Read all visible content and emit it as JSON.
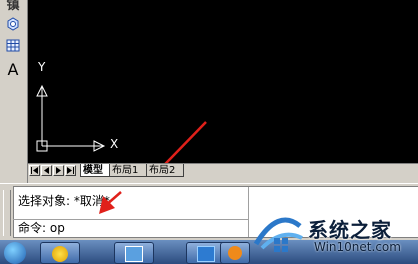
{
  "palette": {
    "edge_glyph": "镇",
    "text_tool_glyph": "A",
    "icons": [
      "hatch-icon",
      "region-icon",
      "table-icon",
      "text-tool-icon"
    ]
  },
  "canvas": {
    "background": "#000000",
    "ucs": {
      "y_label": "Y",
      "x_label": "X"
    },
    "arrow_color": "#e0201a"
  },
  "tabs": {
    "nav_buttons": [
      "first",
      "previous",
      "next",
      "last"
    ],
    "items": [
      {
        "label": "模型",
        "active": true
      },
      {
        "label": "布局1",
        "active": false
      },
      {
        "label": "布局2",
        "active": false
      }
    ]
  },
  "command": {
    "history_line": "选择对象: *取消*",
    "prompt_line": "命令: op"
  },
  "watermark": {
    "title": "系统之家",
    "url": "Win10net.com"
  }
}
